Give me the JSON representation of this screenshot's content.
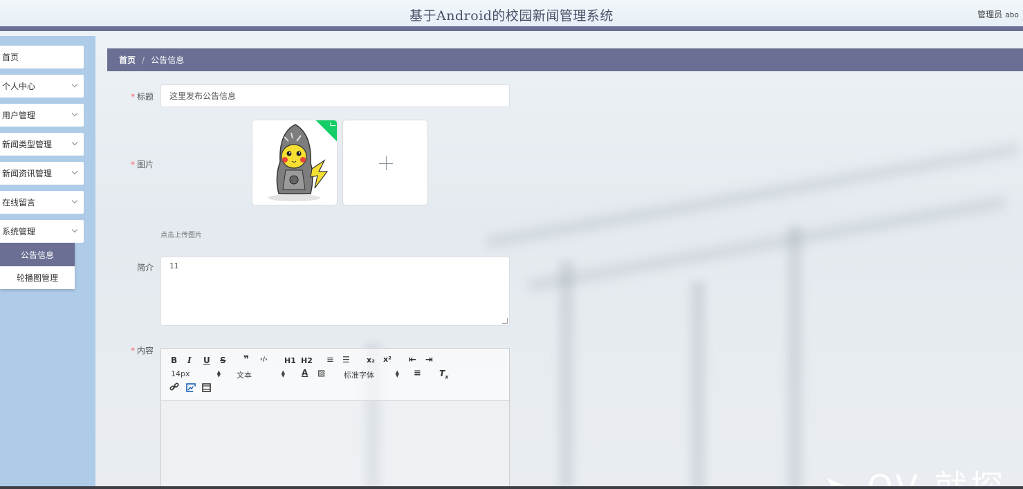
{
  "header": {
    "title": "基于Android的校园新闻管理系统",
    "role": "管理员",
    "username": "abo"
  },
  "sidebar": {
    "items": [
      {
        "label": "首页",
        "has_arrow": false
      },
      {
        "label": "个人中心",
        "has_arrow": true
      },
      {
        "label": "用户管理",
        "has_arrow": true
      },
      {
        "label": "新闻类型管理",
        "has_arrow": true
      },
      {
        "label": "新闻资讯管理",
        "has_arrow": true
      },
      {
        "label": "在线留言",
        "has_arrow": true
      },
      {
        "label": "系统管理",
        "has_arrow": true
      }
    ],
    "submenu": [
      {
        "label": "公告信息",
        "active": true
      },
      {
        "label": "轮播图管理",
        "active": false
      }
    ]
  },
  "breadcrumb": {
    "home": "首页",
    "separator": "/",
    "current": "公告信息"
  },
  "form": {
    "title_label": "标题",
    "title_value": "这里发布公告信息",
    "image_label": "图片",
    "upload_hint": "点击上传图片",
    "summary_label": "简介",
    "summary_value": "11",
    "content_label": "内容",
    "required_mark": "*"
  },
  "editor": {
    "buttons": {
      "bold": "B",
      "italic": "I",
      "underline": "U",
      "strike": "S",
      "blockquote": "❞",
      "code": "‹/›",
      "h1": "H1",
      "h2": "H2",
      "ordered_list": "≡",
      "bullet_list": "☰",
      "subscript": "x₂",
      "superscript": "x²",
      "outdent": "⇤",
      "indent": "⇥"
    },
    "size_picker": "14px",
    "header_picker": "文本",
    "font_picker": "标准字体"
  },
  "colors": {
    "accent": "#6a6f93",
    "sidebar_bg": "#aecbe7",
    "required": "#f56c6c",
    "success": "#13ce66"
  }
}
